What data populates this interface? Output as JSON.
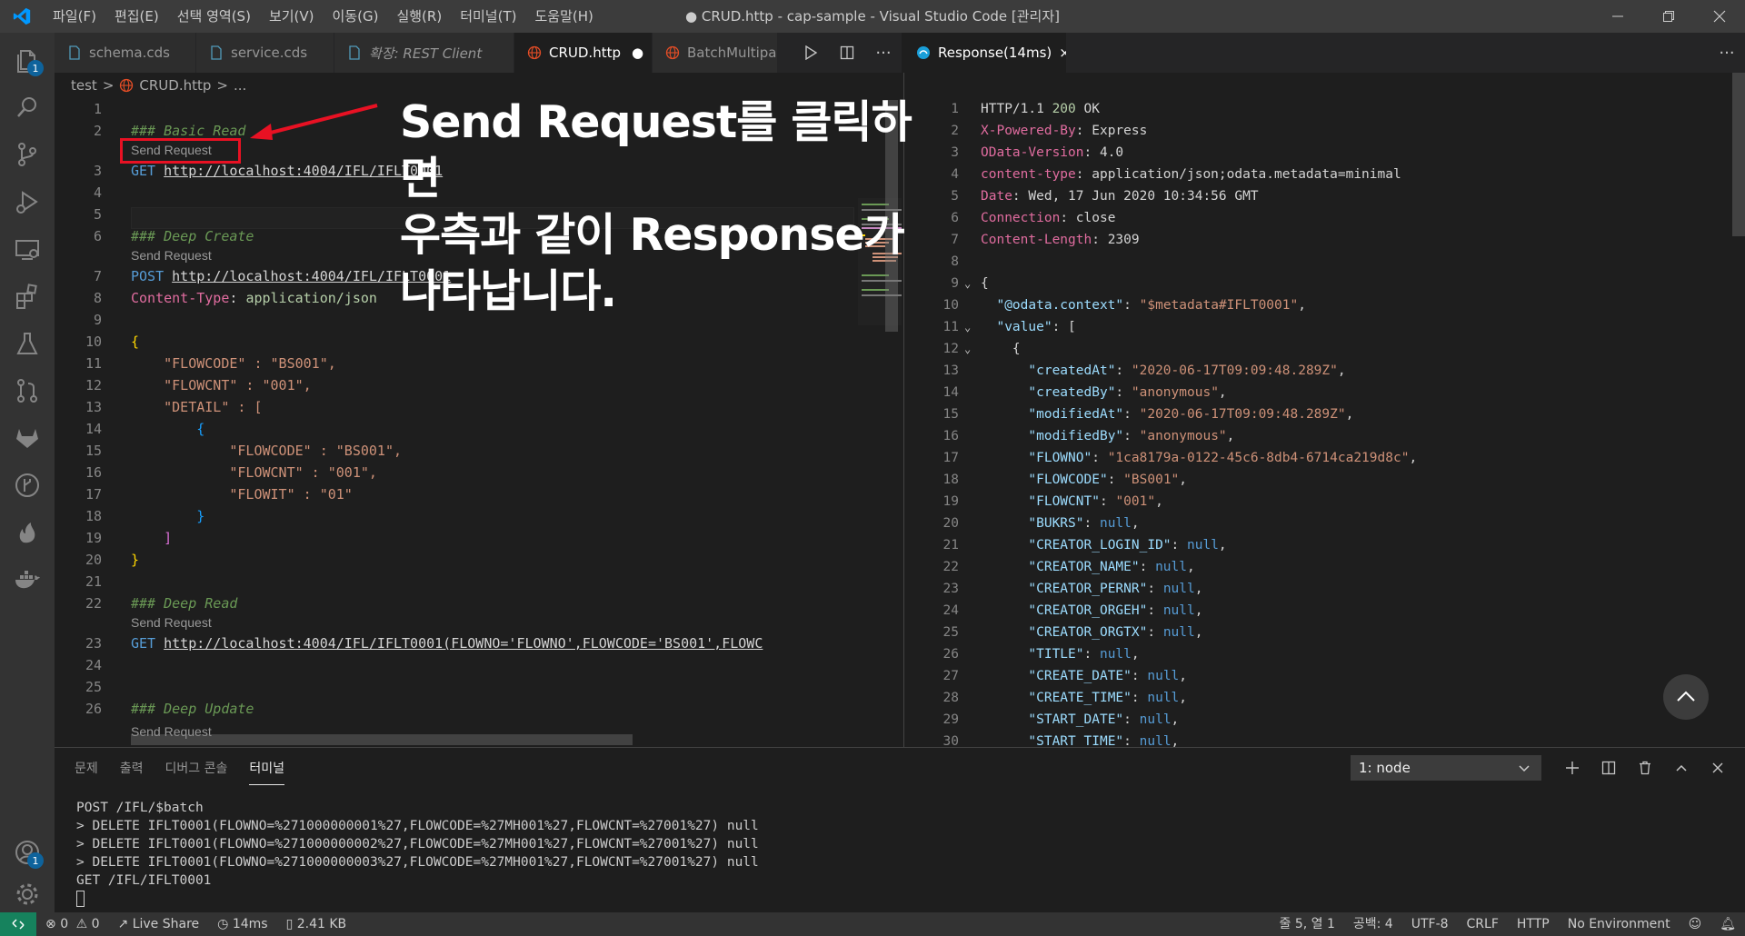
{
  "title_bar": {
    "menu": [
      "파일(F)",
      "편집(E)",
      "선택 영역(S)",
      "보기(V)",
      "이동(G)",
      "실행(R)",
      "터미널(T)",
      "도움말(H)"
    ],
    "window_title": "● CRUD.http - cap-sample - Visual Studio Code [관리자]"
  },
  "activity_bar": {
    "badge_explorer": "1",
    "badge_accounts": "1"
  },
  "tabs": [
    {
      "label": "schema.cds"
    },
    {
      "label": "service.cds"
    },
    {
      "label": "확장: REST Client"
    },
    {
      "label": "CRUD.http",
      "modified": "●"
    },
    {
      "label": "BatchMultipart"
    }
  ],
  "response_tab": {
    "label": "Response(14ms)",
    "close": "×"
  },
  "breadcrumb": {
    "folder": "test",
    "sep1": ">",
    "file": "CRUD.http",
    "sep2": ">",
    "rest": "..."
  },
  "editor": {
    "codelens": "Send Request",
    "lines": [
      {
        "n": "1"
      },
      {
        "n": "2",
        "comment": "### Basic Read"
      },
      {
        "n": "3",
        "method": "GET",
        "url": "http://localhost:4004/IFL/IFLT0001"
      },
      {
        "n": "4"
      },
      {
        "n": "5"
      },
      {
        "n": "6",
        "comment": "### Deep Create"
      },
      {
        "n": "7",
        "method": "POST",
        "url": "http://localhost:4004/IFL/IFLT0001"
      },
      {
        "n": "8",
        "header_key": "Content-Type",
        "header_val": "application/json"
      },
      {
        "n": "9"
      },
      {
        "n": "10",
        "text": "{"
      },
      {
        "n": "11",
        "text": "    \"FLOWCODE\" : \"BS001\","
      },
      {
        "n": "12",
        "text": "    \"FLOWCNT\" : \"001\","
      },
      {
        "n": "13",
        "text": "    \"DETAIL\" : ["
      },
      {
        "n": "14",
        "text": "        {"
      },
      {
        "n": "15",
        "text": "            \"FLOWCODE\" : \"BS001\","
      },
      {
        "n": "16",
        "text": "            \"FLOWCNT\" : \"001\","
      },
      {
        "n": "17",
        "text": "            \"FLOWIT\" : \"01\""
      },
      {
        "n": "18",
        "text": "        }"
      },
      {
        "n": "19",
        "text": "    ]"
      },
      {
        "n": "20",
        "text": "}"
      },
      {
        "n": "21"
      },
      {
        "n": "22",
        "comment": "### Deep Read"
      },
      {
        "n": "23",
        "method": "GET",
        "url": "http://localhost:4004/IFL/IFLT0001(FLOWNO='FLOWNO',FLOWCODE='BS001',FLOWC"
      },
      {
        "n": "24"
      },
      {
        "n": "25"
      },
      {
        "n": "26",
        "comment": "### Deep Update"
      }
    ]
  },
  "response": {
    "lines": [
      {
        "n": "1",
        "text": "HTTP/1.1 ",
        "status": "200",
        "rest": " OK"
      },
      {
        "n": "2",
        "k": "X-Powered-By",
        "v": "Express"
      },
      {
        "n": "3",
        "k": "OData-Version",
        "v": "4.0"
      },
      {
        "n": "4",
        "k": "content-type",
        "v": "application/json;odata.metadata=minimal"
      },
      {
        "n": "5",
        "k": "Date",
        "v": "Wed, 17 Jun 2020 10:34:56 GMT"
      },
      {
        "n": "6",
        "k": "Connection",
        "v": "close"
      },
      {
        "n": "7",
        "k": "Content-Length",
        "v": "2309"
      },
      {
        "n": "8"
      },
      {
        "n": "9",
        "fold": "⌄",
        "raw": "{"
      },
      {
        "n": "10",
        "ind": "  ",
        "jk": "\"@odata.context\"",
        "jv": "\"$metadata#IFLT0001\"",
        "tail": ","
      },
      {
        "n": "11",
        "fold": "⌄",
        "ind": "  ",
        "jk": "\"value\"",
        "raw2": "["
      },
      {
        "n": "12",
        "fold": "⌄",
        "ind": "    ",
        "raw": "{"
      },
      {
        "n": "13",
        "ind": "      ",
        "jk": "\"createdAt\"",
        "jv": "\"2020-06-17T09:09:48.289Z\"",
        "tail": ","
      },
      {
        "n": "14",
        "ind": "      ",
        "jk": "\"createdBy\"",
        "jv": "\"anonymous\"",
        "tail": ","
      },
      {
        "n": "15",
        "ind": "      ",
        "jk": "\"modifiedAt\"",
        "jv": "\"2020-06-17T09:09:48.289Z\"",
        "tail": ","
      },
      {
        "n": "16",
        "ind": "      ",
        "jk": "\"modifiedBy\"",
        "jv": "\"anonymous\"",
        "tail": ","
      },
      {
        "n": "17",
        "ind": "      ",
        "jk": "\"FLOWNO\"",
        "jv": "\"1ca8179a-0122-45c6-8db4-6714ca219d8c\"",
        "tail": ","
      },
      {
        "n": "18",
        "ind": "      ",
        "jk": "\"FLOWCODE\"",
        "jv": "\"BS001\"",
        "tail": ","
      },
      {
        "n": "19",
        "ind": "      ",
        "jk": "\"FLOWCNT\"",
        "jv": "\"001\"",
        "tail": ","
      },
      {
        "n": "20",
        "ind": "      ",
        "jk": "\"BUKRS\"",
        "jn": "null",
        "tail": ","
      },
      {
        "n": "21",
        "ind": "      ",
        "jk": "\"CREATOR_LOGIN_ID\"",
        "jn": "null",
        "tail": ","
      },
      {
        "n": "22",
        "ind": "      ",
        "jk": "\"CREATOR_NAME\"",
        "jn": "null",
        "tail": ","
      },
      {
        "n": "23",
        "ind": "      ",
        "jk": "\"CREATOR_PERNR\"",
        "jn": "null",
        "tail": ","
      },
      {
        "n": "24",
        "ind": "      ",
        "jk": "\"CREATOR_ORGEH\"",
        "jn": "null",
        "tail": ","
      },
      {
        "n": "25",
        "ind": "      ",
        "jk": "\"CREATOR_ORGTX\"",
        "jn": "null",
        "tail": ","
      },
      {
        "n": "26",
        "ind": "      ",
        "jk": "\"TITLE\"",
        "jn": "null",
        "tail": ","
      },
      {
        "n": "27",
        "ind": "      ",
        "jk": "\"CREATE_DATE\"",
        "jn": "null",
        "tail": ","
      },
      {
        "n": "28",
        "ind": "      ",
        "jk": "\"CREATE_TIME\"",
        "jn": "null",
        "tail": ","
      },
      {
        "n": "29",
        "ind": "      ",
        "jk": "\"START_DATE\"",
        "jn": "null",
        "tail": ","
      },
      {
        "n": "30",
        "ind": "      ",
        "jk": "\"START_TIME\"",
        "jn": "null",
        "tail": ","
      }
    ]
  },
  "panel": {
    "tabs": [
      "문제",
      "출력",
      "디버그 콘솔",
      "터미널"
    ],
    "terminal_select": "1: node",
    "terminal_lines": [
      "POST /IFL/$batch",
      "> DELETE IFLT0001(FLOWNO=%271000000001%27,FLOWCODE=%27MH001%27,FLOWCNT=%27001%27) null",
      "> DELETE IFLT0001(FLOWNO=%271000000002%27,FLOWCODE=%27MH001%27,FLOWCNT=%27001%27) null",
      "> DELETE IFLT0001(FLOWNO=%271000000003%27,FLOWCODE=%27MH001%27,FLOWCNT=%27001%27) null",
      "GET /IFL/IFLT0001"
    ]
  },
  "status_bar": {
    "errors": "0",
    "warnings": "0",
    "live_share": "Live Share",
    "time": "14ms",
    "size": "2.41 KB",
    "position": "줄 5, 열 1",
    "spaces": "공백: 4",
    "encoding": "UTF-8",
    "eol": "CRLF",
    "language": "HTTP",
    "environment": "No Environment"
  },
  "annotation": {
    "line1": "Send Request를 클릭하면",
    "line2": "우측과 같이 Response가",
    "line3": "나타납니다."
  },
  "colors": {
    "accent": "#007acc",
    "annotation_red": "#e81123"
  }
}
